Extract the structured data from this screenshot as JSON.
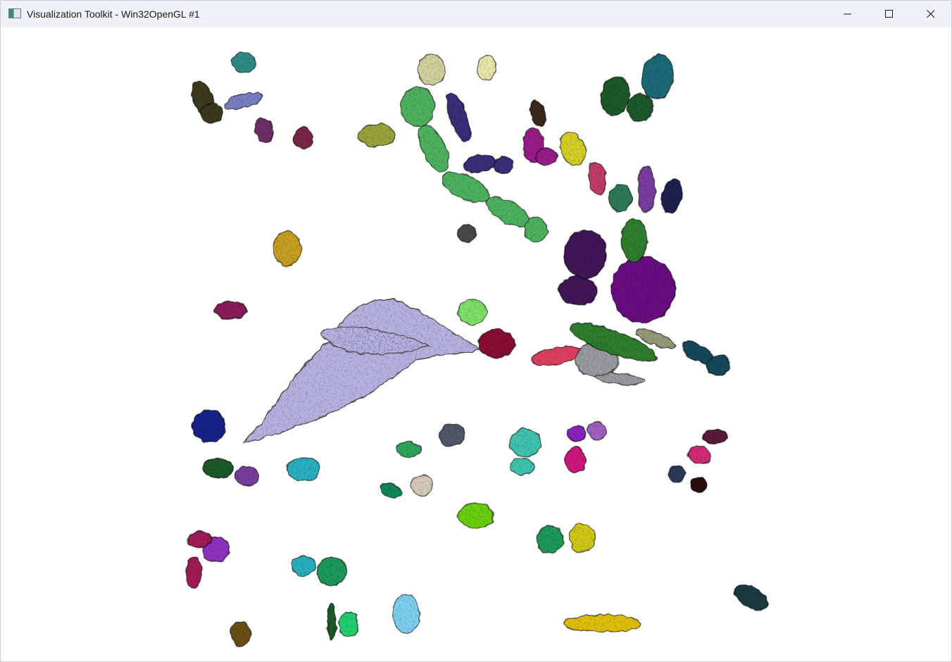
{
  "window": {
    "title": "Visualization Toolkit - Win32OpenGL #1",
    "icon": "vtk-app-icon",
    "controls": [
      "minimize-icon",
      "maximize-icon",
      "close-icon"
    ]
  },
  "scene": {
    "background": "#ffffff",
    "blob_colors": [
      "#3e3a1e",
      "#2f8c8a",
      "#7a7fc4",
      "#6e2f66",
      "#7a2648",
      "#9aa43a",
      "#d2d2a0",
      "#4db35e",
      "#3b2f7a",
      "#e9e8a8",
      "#1f5a2a",
      "#1c6a78",
      "#3a2a1e",
      "#9a1f8a",
      "#d6d028",
      "#c23a6a",
      "#2f7a58",
      "#7a3ea0",
      "#1a2350",
      "#b7b2e2",
      "#4a4a4a",
      "#c7a020",
      "#8a1f5a",
      "#7fe06a",
      "#8a1030",
      "#e04060",
      "#9a9aa2",
      "#3f1358",
      "#6a0f82",
      "#2e7f2e",
      "#9a9a7a",
      "#124a5c",
      "#15208a",
      "#2bb0c0",
      "#2ea85a",
      "#0f8a5a",
      "#d8cab8",
      "#4f5a6a",
      "#3fc4b0",
      "#8a20c0",
      "#a060c0",
      "#d01880",
      "#5a1a3a",
      "#d42a7a",
      "#2a3a5a",
      "#2a0f08",
      "#6ad010",
      "#1f9a5a",
      "#d2c818",
      "#9030c0",
      "#a01a58",
      "#7fd0f0",
      "#22d070",
      "#6a5018",
      "#e0c010",
      "#1a3a40"
    ]
  }
}
